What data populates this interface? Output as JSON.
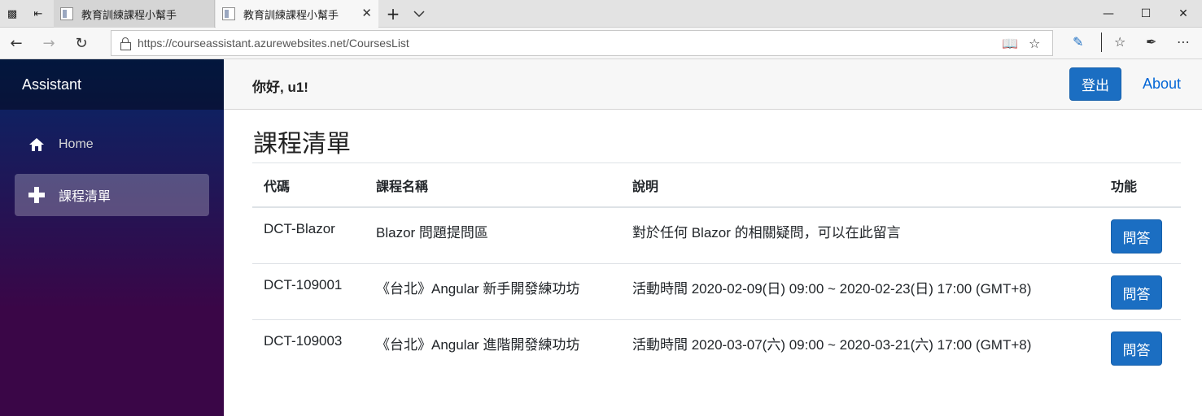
{
  "browser": {
    "tabs": [
      {
        "title": "教育訓練課程小幫手",
        "active": false
      },
      {
        "title": "教育訓練課程小幫手",
        "active": true
      }
    ],
    "new_tab_icon": "+",
    "tab_list_icon": "chevron-down-icon",
    "url": "https://courseassistant.azurewebsites.net/CoursesList",
    "window_controls": [
      "minimize",
      "maximize",
      "close"
    ]
  },
  "app": {
    "brand": "Assistant",
    "nav": [
      {
        "label": "Home",
        "icon": "home-icon",
        "active": false
      },
      {
        "label": "課程清單",
        "icon": "plus-icon",
        "active": true
      }
    ],
    "greeting": "你好, u1!",
    "logout_label": "登出",
    "about_label": "About",
    "accent_color": "#1b6ec2",
    "link_color": "#0366d6"
  },
  "main": {
    "title": "課程清單",
    "table": {
      "headers": [
        "代碼",
        "課程名稱",
        "說明",
        "功能"
      ],
      "rows": [
        {
          "code": "DCT-Blazor",
          "name": "Blazor 問題提問區",
          "desc": "對於任何 Blazor 的相關疑問，可以在此留言",
          "action": "問答"
        },
        {
          "code": "DCT-109001",
          "name": "《台北》Angular 新手開發練功坊",
          "desc": "活動時間 2020-02-09(日) 09:00 ~ 2020-02-23(日) 17:00 (GMT+8)",
          "action": "問答"
        },
        {
          "code": "DCT-109003",
          "name": "《台北》Angular 進階開發練功坊",
          "desc": "活動時間 2020-03-07(六) 09:00 ~ 2020-03-21(六) 17:00 (GMT+8)",
          "action": "問答"
        }
      ]
    }
  }
}
